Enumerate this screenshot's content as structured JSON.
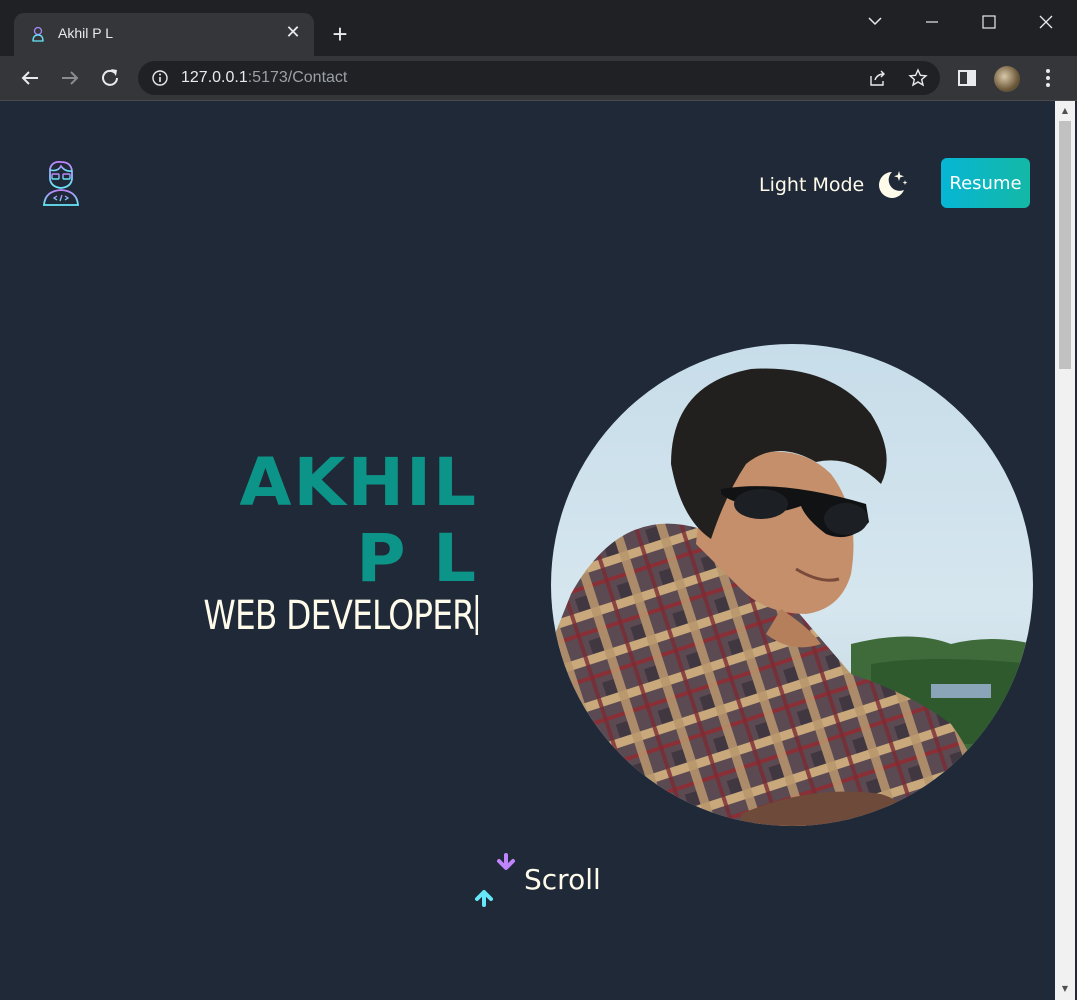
{
  "browser": {
    "tab_title": "Akhil P L",
    "url_host": "127.0.0.1",
    "url_rest": ":5173/Contact"
  },
  "header": {
    "mode_label": "Light Mode",
    "resume_label": "Resume"
  },
  "hero": {
    "name_line1": "AKHIL",
    "name_line2": "P L",
    "role": "WEB DEVELOPER"
  },
  "scroll_hint": {
    "label": "Scroll"
  },
  "colors": {
    "page_bg": "#1f2937",
    "accent_teal": "#0d9488",
    "cream_text": "#fffbeb",
    "button_gradient_start": "#06b6d4",
    "button_gradient_end": "#14b8a6",
    "arrow_down": "#c084fc",
    "arrow_up": "#67e8f9"
  },
  "icons": {
    "logo": "developer-avatar-icon",
    "mode": "moon-stars-icon",
    "scroll": "scroll-arrows-icon"
  }
}
